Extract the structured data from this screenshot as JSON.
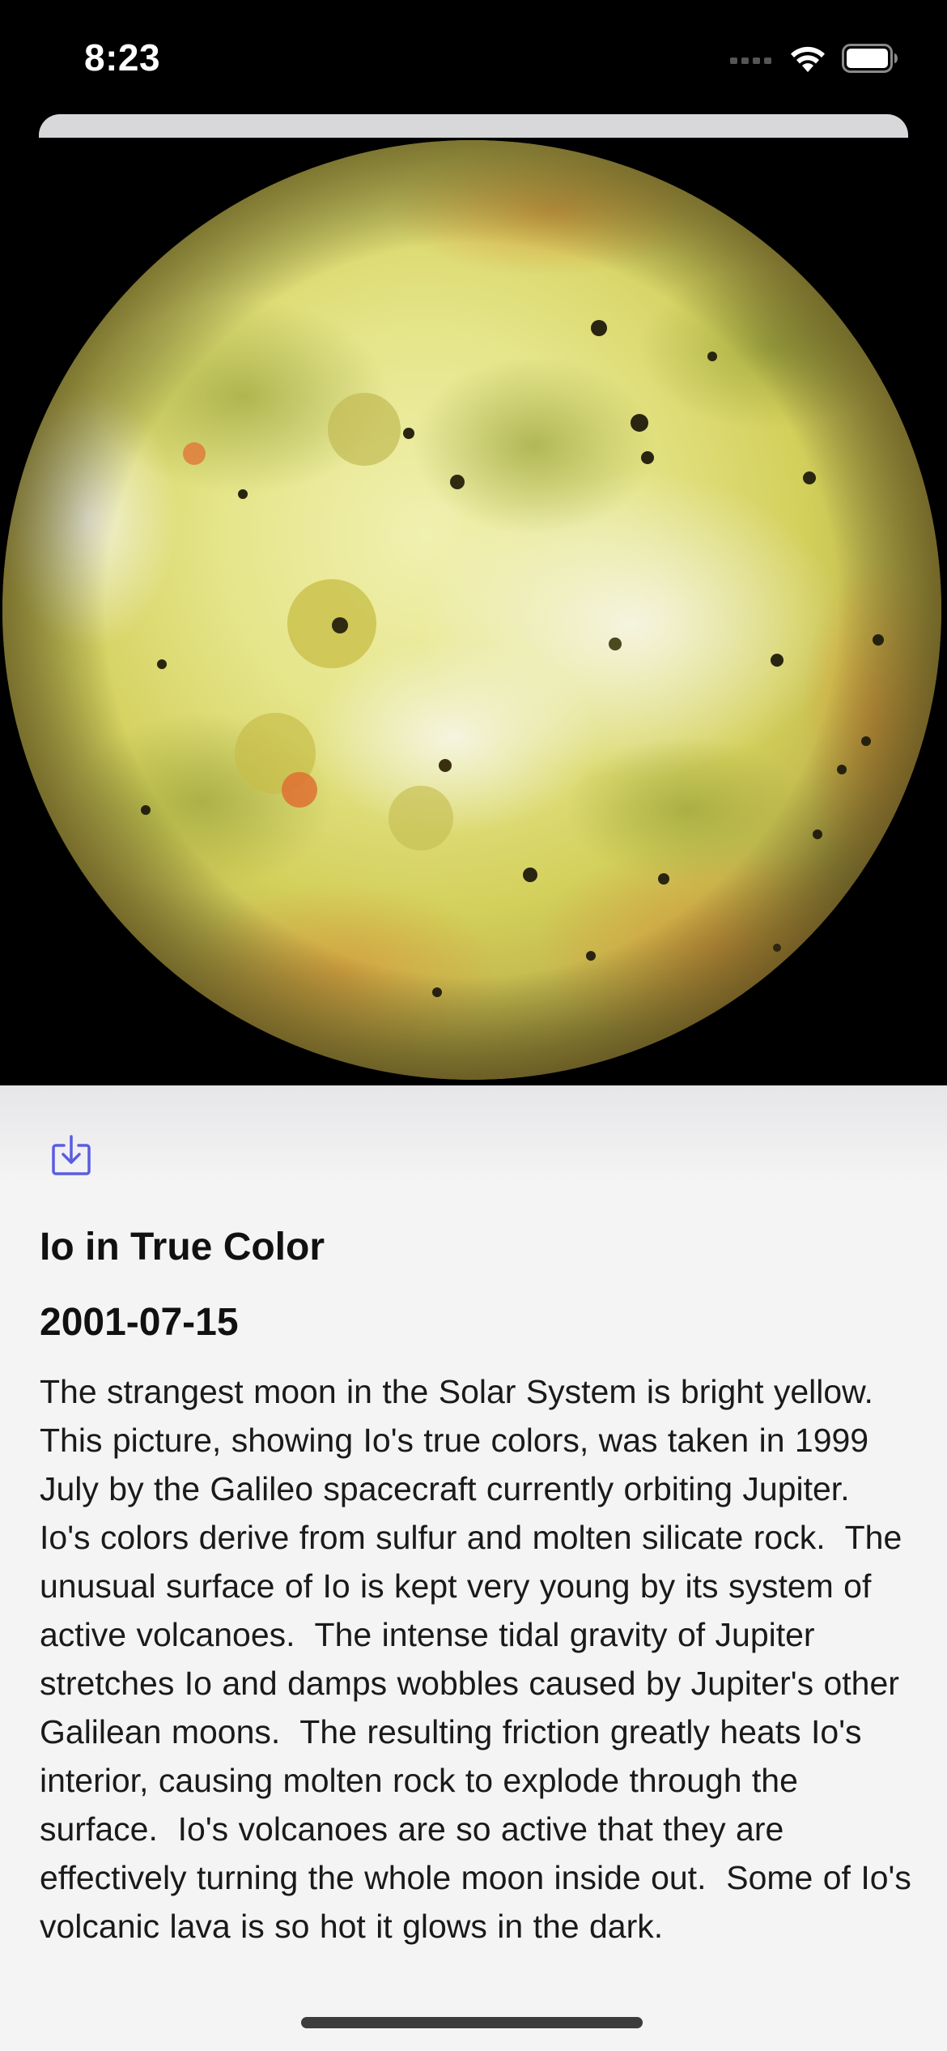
{
  "status_bar": {
    "time": "8:23",
    "icons": [
      "cellular-signal-icon",
      "wifi-icon",
      "battery-icon"
    ]
  },
  "photo": {
    "subject": "Io",
    "background_color": "#000000"
  },
  "actions": {
    "download_icon": "download-icon",
    "accent_color": "#5b5ce0"
  },
  "article": {
    "title": "Io in True Color",
    "date": "2001-07-15",
    "explanation": "The strangest moon in the Solar System is bright yellow.  This picture, showing Io's true colors, was taken in 1999 July by the Galileo spacecraft currently orbiting Jupiter.  Io's colors derive from sulfur and molten silicate rock.  The unusual surface of Io is kept very young by its system of active volcanoes.  The intense tidal gravity of Jupiter stretches Io and damps wobbles caused by Jupiter's other Galilean moons.  The resulting friction greatly heats Io's interior, causing molten rock to explode through the surface.  Io's volcanoes are so active that they are effectively turning the whole moon inside out.  Some of Io's volcanic lava is so hot it glows in the dark."
  }
}
